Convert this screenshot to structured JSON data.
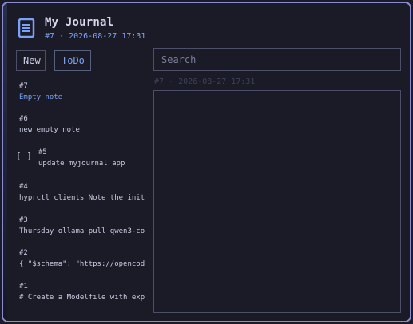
{
  "app": {
    "title": "My Journal",
    "subtitle": "#7 · 2026-08-27 17:31",
    "icon": "journal-icon"
  },
  "toolbar": {
    "new_label": "New",
    "todo_label": "ToDo"
  },
  "search": {
    "placeholder": "Search",
    "value": ""
  },
  "editor": {
    "meta": "#7 · 2026-08-27 17:31",
    "content": ""
  },
  "notes": [
    {
      "id": "#7",
      "text": "Empty note",
      "active": true
    },
    {
      "id": "#6",
      "text": "new empty note"
    },
    {
      "id": "#5",
      "text": "update myjournal app",
      "todo": true,
      "checkbox": "[ ]"
    },
    {
      "id": "#4",
      "text": "hyprctl clients Note the init"
    },
    {
      "id": "#3",
      "text": "Thursday ollama pull qwen3-co"
    },
    {
      "id": "#2",
      "text": "{ \"$schema\": \"https://opencod"
    },
    {
      "id": "#1",
      "text": "# Create a Modelfile with exp"
    }
  ],
  "colors": {
    "accent": "#7aa2f7",
    "background": "#1a1b26",
    "border": "#4b5068",
    "text": "#c9cce2",
    "window_border": "#8b8bd0"
  }
}
